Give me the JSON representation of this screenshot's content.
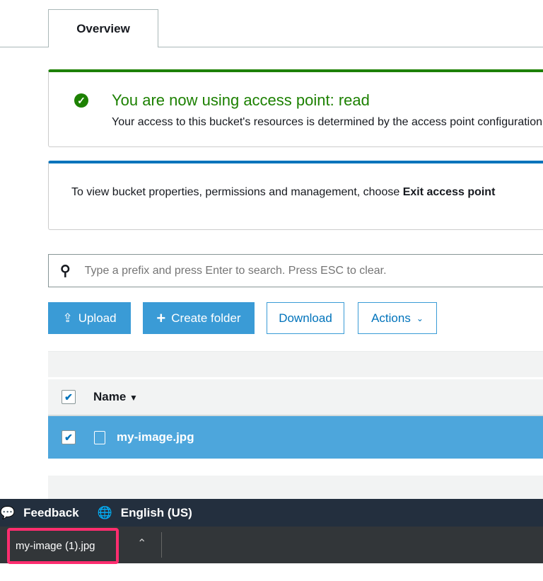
{
  "tabs": {
    "overview": "Overview"
  },
  "success": {
    "title": "You are now using access point: read",
    "body": "Your access to this bucket's resources is determined by the access point configuration."
  },
  "info": {
    "text": "To view bucket properties, permissions and management, choose ",
    "bold": "Exit access point"
  },
  "search": {
    "placeholder": "Type a prefix and press Enter to search. Press ESC to clear."
  },
  "toolbar": {
    "upload": "Upload",
    "create_folder": "Create folder",
    "download": "Download",
    "actions": "Actions"
  },
  "table": {
    "name_header": "Name",
    "rows": [
      {
        "name": "my-image.jpg",
        "selected": true
      }
    ]
  },
  "footer": {
    "feedback": "Feedback",
    "language": "English (US)"
  },
  "download_bar": {
    "file": "my-image (1).jpg"
  }
}
